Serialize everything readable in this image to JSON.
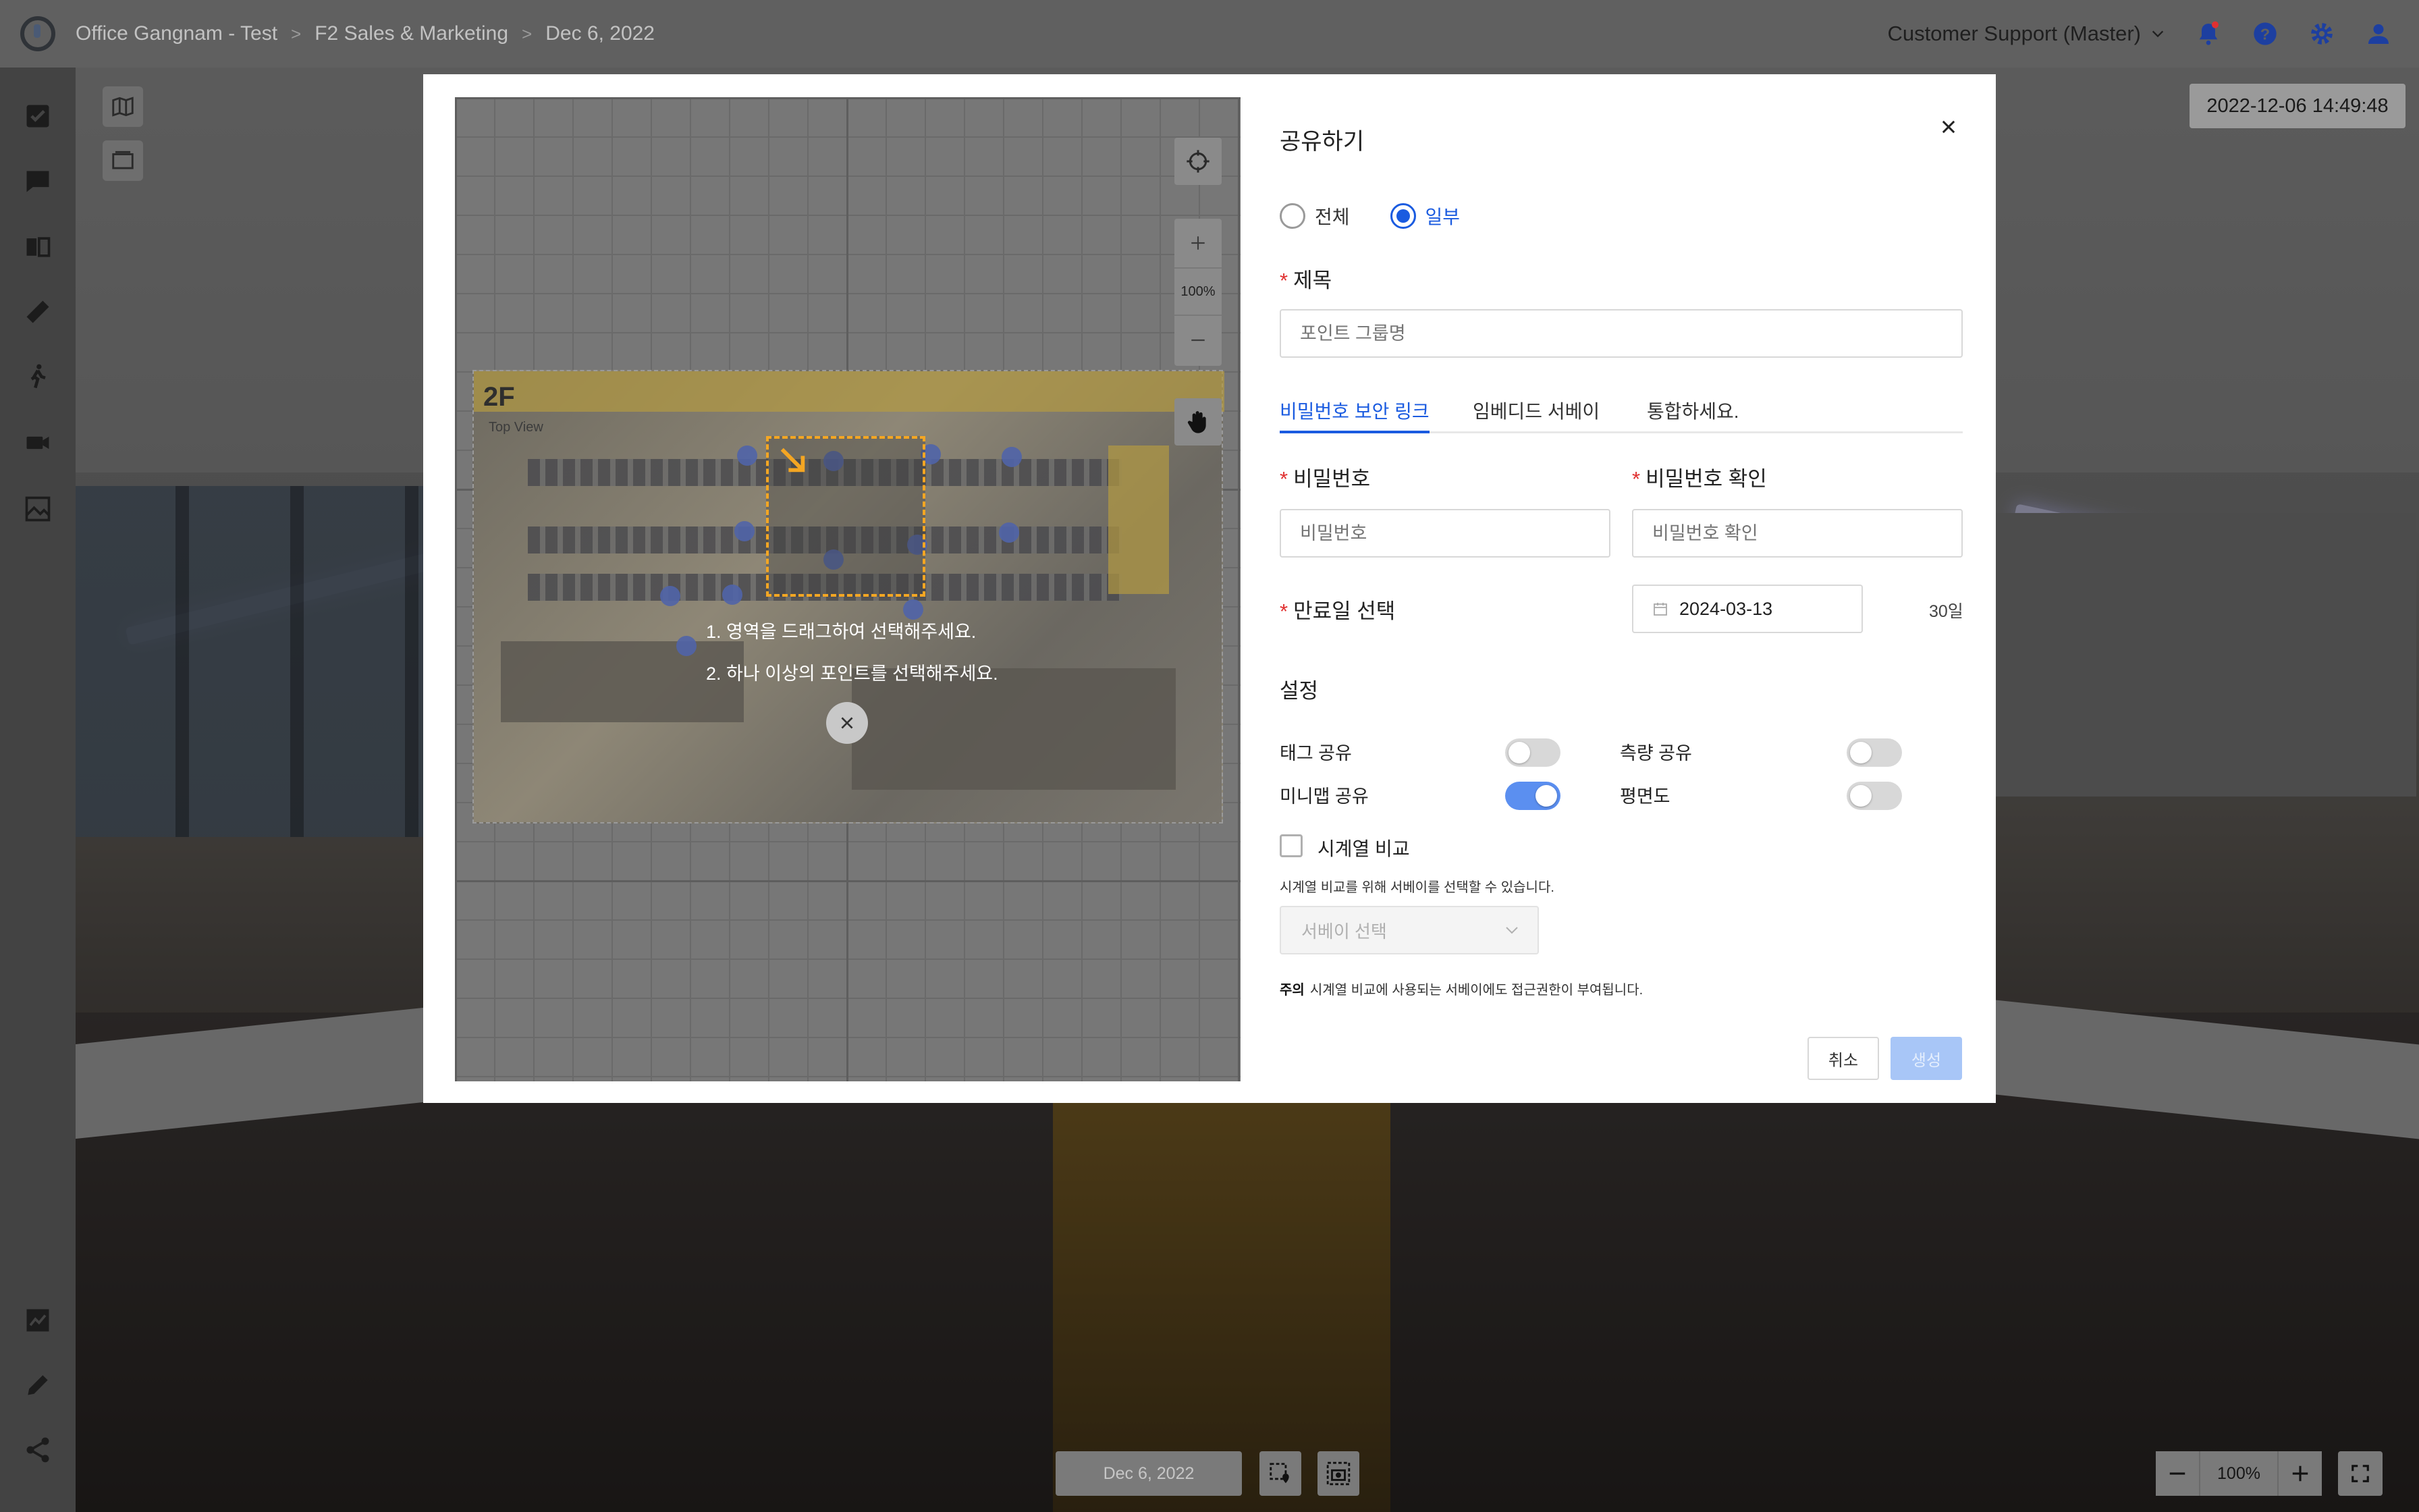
{
  "breadcrumb": {
    "items": [
      "Office Gangnam - Test",
      "F2 Sales & Marketing",
      "Dec 6, 2022"
    ]
  },
  "topbar": {
    "account": "Customer Support (Master)",
    "icons": [
      "notification-bell-icon",
      "help-icon",
      "settings-gear-icon",
      "user-icon"
    ]
  },
  "sidebar": {
    "icons": [
      "checklist-icon",
      "comment-icon",
      "compare-icon",
      "ruler-icon",
      "walk-icon",
      "video-icon",
      "image-compare-icon",
      "chart-icon",
      "pencil-icon",
      "share-icon"
    ]
  },
  "viewer": {
    "timestamp": "2022-12-06 14:49:48",
    "date": "Dec 6, 2022",
    "zoom": "100%"
  },
  "map": {
    "zoom": "100%",
    "floor_label": "2F",
    "floor_sublabel": "Top View",
    "instruction_1": "1. 영역을 드래그하여 선택해주세요.",
    "instruction_2": "2. 하나 이상의 포인트를 선택해주세요."
  },
  "modal": {
    "title": "공유하기",
    "scope_options": [
      {
        "label": "전체",
        "selected": false
      },
      {
        "label": "일부",
        "selected": true
      }
    ],
    "title_label": "제목",
    "title_placeholder": "포인트 그룹명",
    "tabs": [
      {
        "label": "비밀번호 보안 링크",
        "active": true
      },
      {
        "label": "임베디드 서베이",
        "active": false
      },
      {
        "label": "통합하세요.",
        "active": false
      }
    ],
    "password_label": "비밀번호",
    "password_placeholder": "비밀번호",
    "password_confirm_label": "비밀번호 확인",
    "password_confirm_placeholder": "비밀번호 확인",
    "expiry_label": "만료일 선택",
    "expiry_date": "2024-03-13",
    "expiry_days": "30일",
    "settings_title": "설정",
    "toggles": {
      "tag_share": {
        "label": "태그 공유",
        "on": false
      },
      "measure_share": {
        "label": "측량 공유",
        "on": false
      },
      "minimap_share": {
        "label": "미니맵 공유",
        "on": true
      },
      "floorplan": {
        "label": "평면도",
        "on": false
      }
    },
    "timeline_compare_label": "시계열 비교",
    "timeline_hint": "시계열 비교를 위해 서베이를 선택할 수 있습니다.",
    "survey_select_placeholder": "서베이 선택",
    "note_prefix": "주의",
    "note_text": "시계열 비교에 사용되는 서베이에도 접근권한이 부여됩니다.",
    "cancel_label": "취소",
    "confirm_label": "생성"
  },
  "colors": {
    "accent": "#1a5be0",
    "required": "#e03030",
    "selection": "#f4a623"
  }
}
